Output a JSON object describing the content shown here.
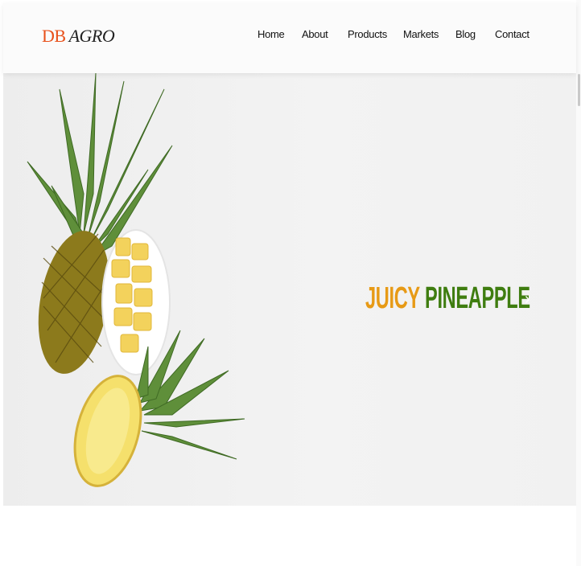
{
  "brand": {
    "part1": "DB",
    "part2": "AGRO",
    "accent": "#e8501a"
  },
  "nav": {
    "items": [
      {
        "label": "Home"
      },
      {
        "label": "About"
      },
      {
        "label": "Products"
      },
      {
        "label": "Markets"
      },
      {
        "label": "Blog"
      },
      {
        "label": "Contact"
      }
    ]
  },
  "hero": {
    "title_word1": "JUICY",
    "title_word2": "PINEAPPLE",
    "word1_color": "#e79a16",
    "word2_color": "#3f7d10",
    "image": "pineapple-photo",
    "next_icon": "chevron-right-icon"
  }
}
